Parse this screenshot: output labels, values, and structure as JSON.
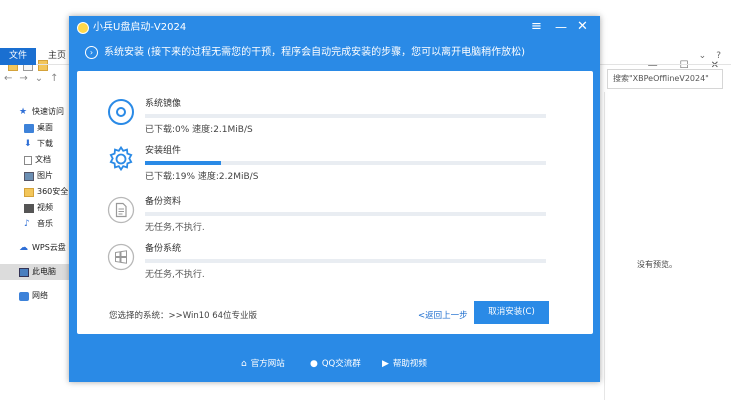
{
  "explorer": {
    "ribbon": {
      "file_tab": "文件",
      "home_tab": "主页"
    },
    "search": {
      "placeholder": "搜索\"XBPeOfflineV2024\""
    },
    "sidebar": {
      "items": [
        {
          "label": "快速访问",
          "icon": "star-icon"
        },
        {
          "label": "桌面",
          "icon": "desktop-icon"
        },
        {
          "label": "下载",
          "icon": "download-icon"
        },
        {
          "label": "文档",
          "icon": "document-icon"
        },
        {
          "label": "图片",
          "icon": "picture-icon"
        },
        {
          "label": "360安全",
          "icon": "folder-icon"
        },
        {
          "label": "视频",
          "icon": "video-icon"
        },
        {
          "label": "音乐",
          "icon": "music-icon"
        },
        {
          "label": "WPS云盘",
          "icon": "cloud-icon"
        },
        {
          "label": "此电脑",
          "icon": "computer-icon"
        },
        {
          "label": "网络",
          "icon": "network-icon"
        }
      ]
    },
    "preview_text": "没有预览。"
  },
  "installer": {
    "title": "小兵U盘启动-V2024",
    "step_text": "系统安装 (接下来的过程无需您的干预，程序会自动完成安装的步骤，您可以离开电脑稍作放松)",
    "tasks": [
      {
        "name": "系统镜像",
        "status": "已下载:0% 速度:2.1MiB/S",
        "progress": 0,
        "icon": "disc-icon",
        "active": true
      },
      {
        "name": "安装组件",
        "status": "已下载:19% 速度:2.2MiB/S",
        "progress": 0.19,
        "icon": "gear-icon",
        "active": true
      },
      {
        "name": "备份资料",
        "status": "无任务,不执行.",
        "progress": 0,
        "icon": "file-backup-icon",
        "active": false
      },
      {
        "name": "备份系统",
        "status": "无任务,不执行.",
        "progress": 0,
        "icon": "windows-backup-icon",
        "active": false
      }
    ],
    "selected_system": "您选择的系统：>>Win10 64位专业版",
    "back_label": "<返回上一步",
    "cancel_label": "取消安装(C)",
    "footer": {
      "website": "官方网站",
      "qq_group": "QQ交流群",
      "help_video": "帮助视频"
    },
    "colors": {
      "accent": "#2a8ae6",
      "track": "#e9edf2"
    }
  }
}
